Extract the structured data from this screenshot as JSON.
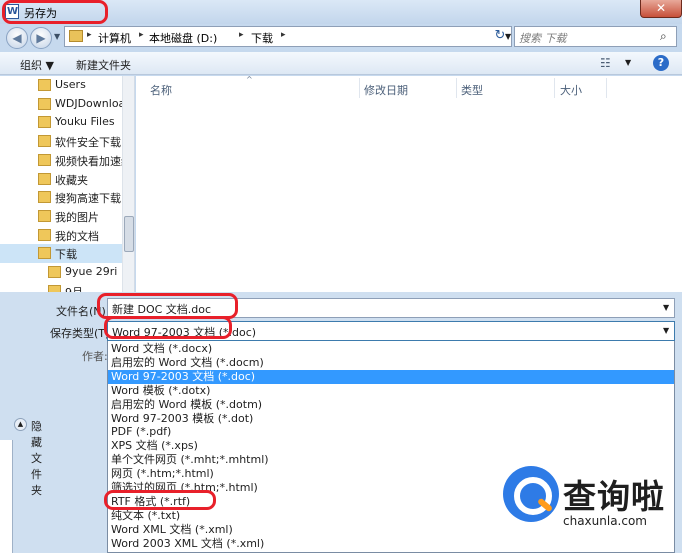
{
  "window": {
    "title": "另存为",
    "close": "✕"
  },
  "address": {
    "crumbs": [
      "计算机",
      "本地磁盘 (D:)",
      "下载"
    ],
    "search_placeholder": "搜索 下载"
  },
  "toolbar": {
    "organize": "组织 ▼",
    "new_folder": "新建文件夹"
  },
  "nav": {
    "items": [
      {
        "label": "Users",
        "selected": false
      },
      {
        "label": "WDJDownload",
        "selected": false
      },
      {
        "label": "Youku Files",
        "selected": false
      },
      {
        "label": "软件安全下载目录",
        "selected": false
      },
      {
        "label": "视频快看加速缓存",
        "selected": false
      },
      {
        "label": "收藏夹",
        "selected": false
      },
      {
        "label": "搜狗高速下载",
        "selected": false
      },
      {
        "label": "我的图片",
        "selected": false
      },
      {
        "label": "我的文档",
        "selected": false
      },
      {
        "label": "下载",
        "selected": true
      },
      {
        "label": "9yue 29ri",
        "selected": false
      },
      {
        "label": "9月",
        "selected": false
      }
    ]
  },
  "columns": [
    "名称",
    "修改日期",
    "类型",
    "大小"
  ],
  "form": {
    "filename_label": "文件名(N):",
    "filename_value": "新建 DOC 文档.doc",
    "filetype_label": "保存类型(T):",
    "filetype_value": "Word 97-2003 文档 (*.doc)",
    "author_label": "作者:",
    "hide_folders": "隐藏文件夹"
  },
  "filetype_options": [
    "Word 文档 (*.docx)",
    "启用宏的 Word 文档 (*.docm)",
    "Word 97-2003 文档 (*.doc)",
    "Word 模板 (*.dotx)",
    "启用宏的 Word 模板 (*.dotm)",
    "Word 97-2003 模板 (*.dot)",
    "PDF (*.pdf)",
    "XPS 文档 (*.xps)",
    "单个文件网页 (*.mht;*.mhtml)",
    "网页 (*.htm;*.html)",
    "筛选过的网页 (*.htm;*.html)",
    "RTF 格式 (*.rtf)",
    "纯文本 (*.txt)",
    "Word XML 文档 (*.xml)",
    "Word 2003 XML 文档 (*.xml)"
  ],
  "highlighted_option": 2,
  "watermark": {
    "brand": "查询啦",
    "url": "chaxunla.com"
  },
  "colors": {
    "annotation": "#e8202a",
    "highlight": "#3399ff"
  }
}
